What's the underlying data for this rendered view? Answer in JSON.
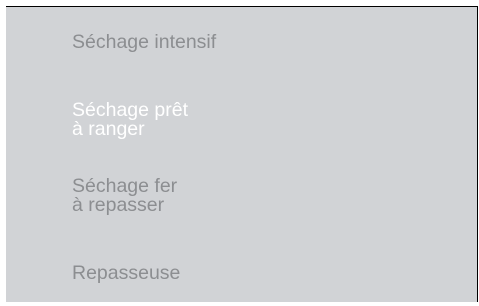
{
  "menu": {
    "items": [
      {
        "lines": [
          "Séchage intensif"
        ],
        "selected": false
      },
      {
        "lines": [
          "Séchage prêt",
          "à ranger"
        ],
        "selected": true
      },
      {
        "lines": [
          "Séchage fer",
          "à repasser"
        ],
        "selected": false
      },
      {
        "lines": [
          "Repasseuse"
        ],
        "selected": false
      }
    ]
  },
  "colors": {
    "background": "#d1d3d6",
    "item_text": "#8c8e91",
    "selected_text": "#ffffff"
  }
}
